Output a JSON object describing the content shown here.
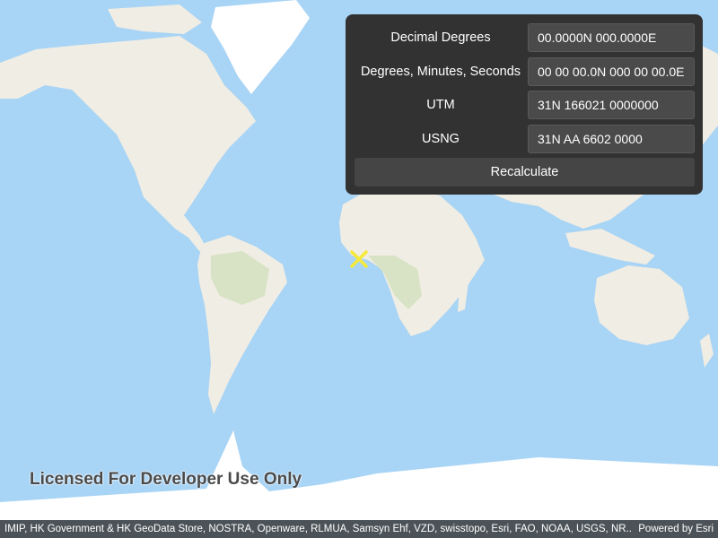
{
  "colors": {
    "ocean": "#a8d4f5",
    "land": "#f0ede4",
    "vegetation": "#d7e3c4",
    "ice": "#ffffff",
    "panel_bg": "#323232",
    "marker": "#f5e93a"
  },
  "marker": {
    "icon": "x-marker-icon",
    "lat": 0,
    "lon": 0
  },
  "panel": {
    "rows": [
      {
        "label": "Decimal Degrees",
        "value": "00.0000N 000.0000E"
      },
      {
        "label": "Degrees, Minutes, Seconds",
        "value": "00 00 00.0N 000 00 00.0E"
      },
      {
        "label": "UTM",
        "value": "31N 166021 0000000"
      },
      {
        "label": "USNG",
        "value": "31N AA 6602 0000"
      }
    ],
    "recalculate_label": "Recalculate"
  },
  "watermark": "Licensed For Developer Use Only",
  "attribution": {
    "text": "IMIP, HK Government & HK GeoData Store, NOSTRA, Openware, RLMUA, Samsyn Ehf, VZD, swisstopo, Esri, FAO, NOAA, USGS, NR...",
    "powered_by": "Powered by Esri"
  }
}
